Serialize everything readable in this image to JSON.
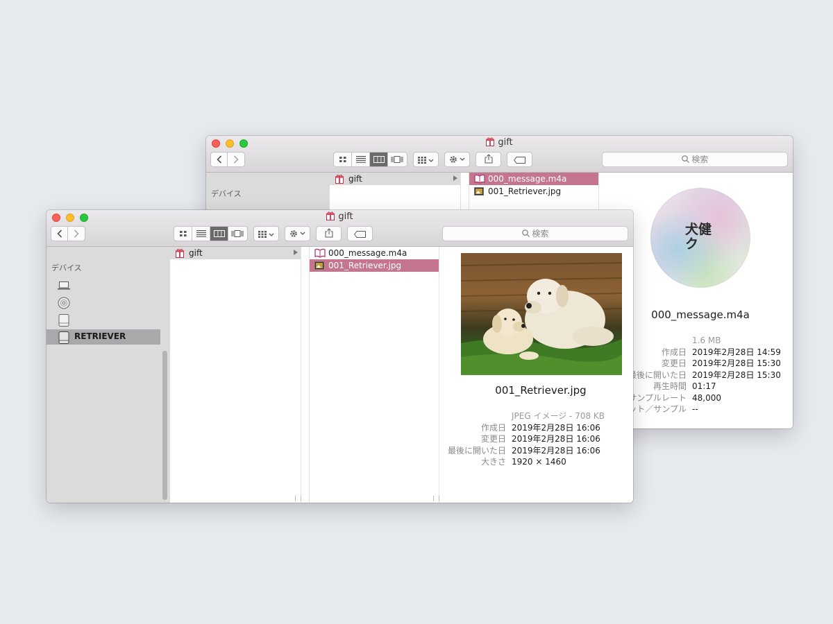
{
  "back_window": {
    "title": "gift",
    "search_placeholder": "検索",
    "sidebar": {
      "section_header": "デバイス"
    },
    "column1": {
      "items": [
        {
          "name": "gift",
          "icon": "gift-folder-icon",
          "has_children": true
        }
      ]
    },
    "column2": {
      "items": [
        {
          "name": "000_message.m4a",
          "icon": "audio-book-icon",
          "selected": true
        },
        {
          "name": "001_Retriever.jpg",
          "icon": "jpeg-image-icon",
          "selected": false
        }
      ]
    },
    "preview": {
      "album_art_text": "犬健ク",
      "album_art_lines": [
        "犬健",
        "ク"
      ],
      "file_name": "000_message.m4a",
      "size": "1.6 MB",
      "metadata": [
        {
          "key": "作成日",
          "value": "2019年2月28日 14:59"
        },
        {
          "key": "変更日",
          "value": "2019年2月28日 15:30"
        },
        {
          "key": "最後に開いた日",
          "value": "2019年2月28日 15:30"
        },
        {
          "key": "再生時間",
          "value": "01:17"
        },
        {
          "key": "サンプルレート",
          "value": "48,000"
        },
        {
          "key": "ビット／サンプル",
          "value": "--"
        }
      ]
    }
  },
  "front_window": {
    "title": "gift",
    "search_placeholder": "検索",
    "sidebar": {
      "section_header": "デバイス",
      "items": [
        {
          "icon": "laptop-icon",
          "label": ""
        },
        {
          "icon": "optical-disc-icon",
          "label": ""
        },
        {
          "icon": "external-drive-icon",
          "label": ""
        },
        {
          "icon": "drive-icon",
          "label": "RETRIEVER",
          "selected": true
        }
      ]
    },
    "column1": {
      "items": [
        {
          "name": "gift",
          "icon": "gift-folder-icon",
          "has_children": true
        }
      ]
    },
    "column2": {
      "items": [
        {
          "name": "000_message.m4a",
          "icon": "audio-book-icon",
          "selected": false
        },
        {
          "name": "001_Retriever.jpg",
          "icon": "jpeg-image-icon",
          "selected": true
        }
      ]
    },
    "preview": {
      "file_name": "001_Retriever.jpg",
      "kind_size": "JPEG イメージ - 708 KB",
      "metadata": [
        {
          "key": "作成日",
          "value": "2019年2月28日 16:06"
        },
        {
          "key": "変更日",
          "value": "2019年2月28日 16:06"
        },
        {
          "key": "最後に開いた日",
          "value": "2019年2月28日 16:06"
        },
        {
          "key": "大きさ",
          "value": "1920 × 1460"
        }
      ]
    }
  },
  "toolbar": {
    "icons": [
      "back-icon",
      "forward-icon",
      "icon-view-icon",
      "list-view-icon",
      "column-view-icon",
      "cover-flow-icon",
      "group-icon",
      "action-gear-icon",
      "share-icon",
      "tag-icon",
      "search-icon"
    ],
    "active_view": "column-view-icon"
  },
  "colors": {
    "desktop": "#e6e9ee",
    "selection": "#c5768e",
    "sidebar": "#dcdbdc",
    "traffic_close": "#fe5f57",
    "traffic_min": "#febc2e",
    "traffic_zoom": "#28c840"
  }
}
